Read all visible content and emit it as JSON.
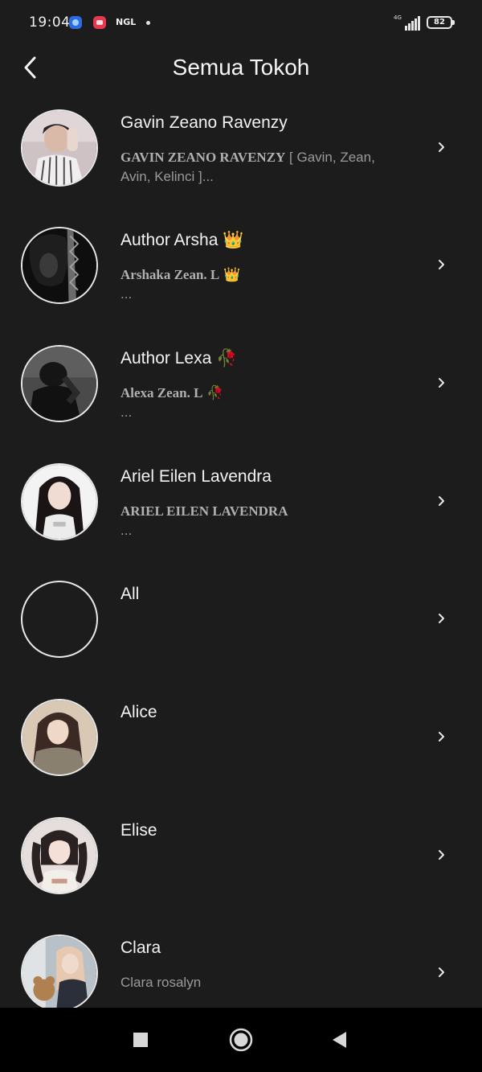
{
  "status_bar": {
    "time": "19:04",
    "notification_text": "NGL",
    "network": "4G",
    "battery": "82"
  },
  "header": {
    "title": "Semua Tokoh"
  },
  "characters": [
    {
      "name": "Gavin Zeano Ravenzy",
      "desc_caps": "GAVIN ZEANO RAVENZY",
      "desc_rest": " [ Gavin, Zean,",
      "desc_line2": "Avin, Kelinci ]...",
      "avatar": "boy-photo"
    },
    {
      "name": "Author Arsha 👑",
      "desc_caps": "Arshaka Zean. L",
      "desc_rest": " 👑",
      "desc_line2": "...",
      "avatar": "dark-hair-photo"
    },
    {
      "name": "Author Lexa 🥀",
      "desc_caps": "Alexa Zean. L",
      "desc_rest": " 🥀",
      "desc_line2": "...",
      "avatar": "monochrome-photo"
    },
    {
      "name": "Ariel Eilen Lavendra",
      "desc_caps": "ARIEL EILEN LAVENDRA",
      "desc_rest": "",
      "desc_line2": "...",
      "avatar": "girl-white-bg"
    },
    {
      "name": "All",
      "desc_caps": "",
      "desc_rest": "",
      "desc_line2": "",
      "avatar": "empty"
    },
    {
      "name": "Alice",
      "desc_caps": "",
      "desc_rest": "",
      "desc_line2": "",
      "avatar": "girl-beige"
    },
    {
      "name": "Elise",
      "desc_caps": "",
      "desc_rest": "",
      "desc_line2": "",
      "avatar": "girl-pigtails"
    },
    {
      "name": "Clara",
      "desc_caps": "",
      "desc_rest": "Clara rosalyn",
      "desc_line2": "",
      "avatar": "girl-bear"
    }
  ],
  "icons": {
    "back": "back-arrow-icon",
    "chevron": "chevron-right-icon",
    "nav_recents": "square-icon",
    "nav_home": "circle-icon",
    "nav_back": "triangle-back-icon"
  },
  "colors": {
    "background": "#1c1c1c",
    "text": "#f2f2f2",
    "muted": "#9a9a9a",
    "nav_bar": "#000000"
  }
}
